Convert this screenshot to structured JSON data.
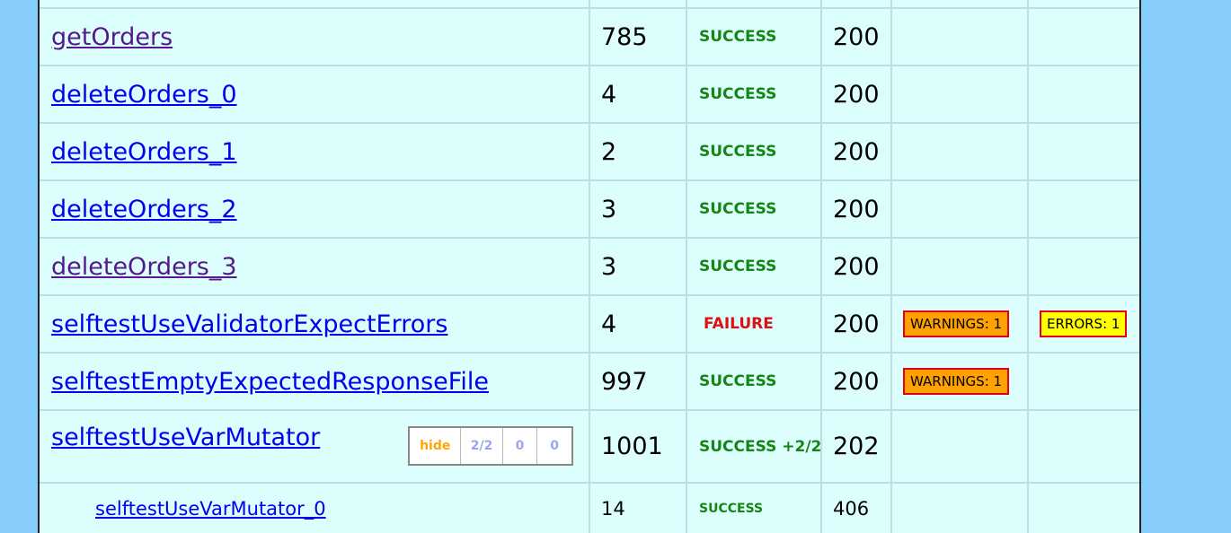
{
  "rows": [
    {
      "name": "getOrders",
      "time": "785",
      "status": "SUCCESS",
      "code": "200"
    },
    {
      "name": "deleteOrders_0",
      "time": "4",
      "status": "SUCCESS",
      "code": "200"
    },
    {
      "name": "deleteOrders_1",
      "time": "2",
      "status": "SUCCESS",
      "code": "200"
    },
    {
      "name": "deleteOrders_2",
      "time": "3",
      "status": "SUCCESS",
      "code": "200"
    },
    {
      "name": "deleteOrders_3",
      "time": "3",
      "status": "SUCCESS",
      "code": "200"
    },
    {
      "name": "selftestUseValidatorExpectErrors",
      "time": "4",
      "status": "FAILURE",
      "code": "200",
      "warnings": "WARNINGS: 1",
      "errors": "ERRORS: 1"
    },
    {
      "name": "selftestEmptyExpectedResponseFile",
      "time": "997",
      "status": "SUCCESS",
      "code": "200",
      "warnings": "WARNINGS: 1"
    },
    {
      "name": "selftestUseVarMutator",
      "time": "1001",
      "status": "SUCCESS +2/2",
      "code": "202"
    },
    {
      "name": "selftestUseVarMutator_0",
      "time": "14",
      "status": "SUCCESS",
      "code": "406"
    }
  ],
  "mutator_controls": {
    "hide": "hide",
    "ratio": "2/2",
    "a": "0",
    "b": "0"
  }
}
